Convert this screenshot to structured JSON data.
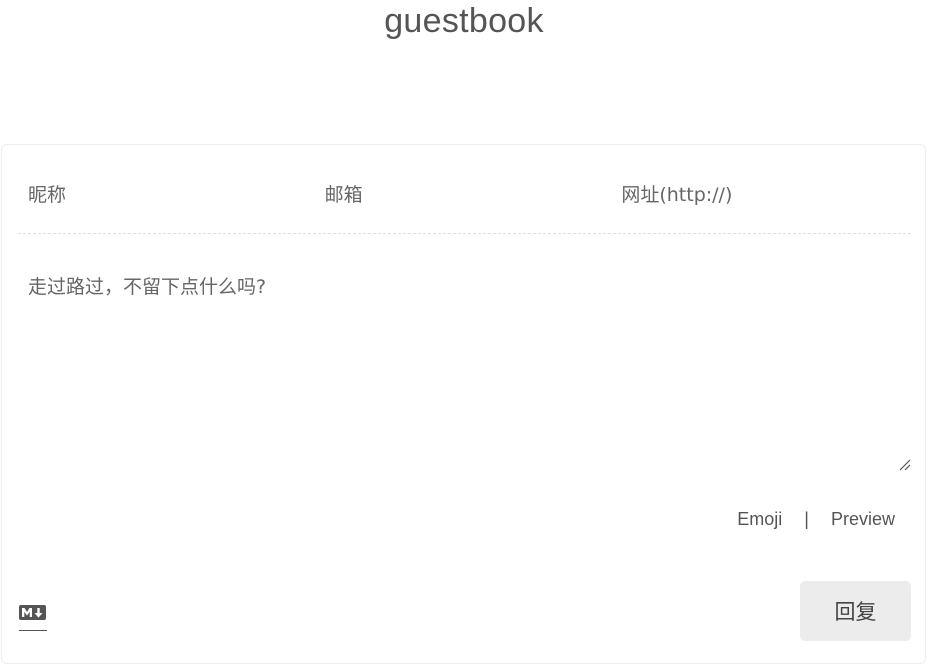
{
  "page": {
    "title": "guestbook"
  },
  "form": {
    "nickname_placeholder": "昵称",
    "email_placeholder": "邮箱",
    "website_placeholder": "网址(http://)",
    "comment_placeholder": "走过路过，不留下点什么吗?"
  },
  "tools": {
    "emoji_label": "Emoji",
    "separator": "|",
    "preview_label": "Preview"
  },
  "markdown_icon": "markdown-icon",
  "resize_icon": "resize-handle-icon",
  "submit": {
    "label": "回复"
  },
  "colors": {
    "title": "#555555",
    "border": "#eeeeee",
    "dashed": "#dedede",
    "button_bg": "#ececec"
  }
}
